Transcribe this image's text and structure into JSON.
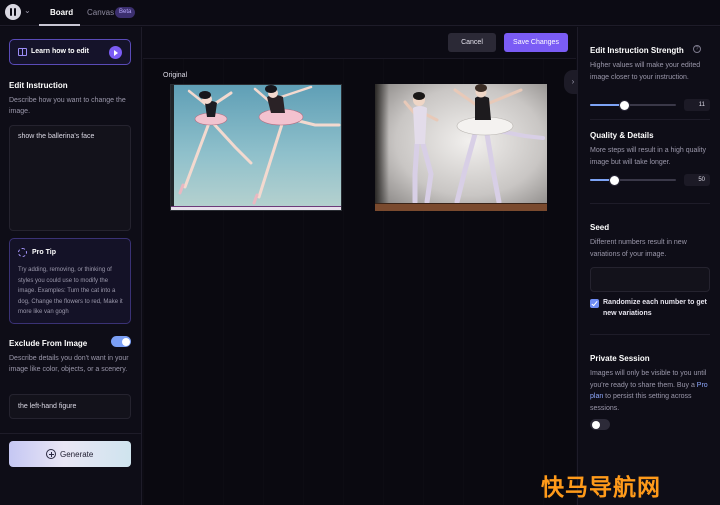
{
  "topbar": {
    "tabs": [
      {
        "label": "Board",
        "active": true
      },
      {
        "label": "Canvas",
        "active": false,
        "badge": "Beta"
      }
    ]
  },
  "left": {
    "learn_button": "Learn how to edit",
    "edit_instruction": {
      "title": "Edit Instruction",
      "description": "Describe how you want to change the image.",
      "value": "show the ballerina's face"
    },
    "pro_tip": {
      "title": "Pro Tip",
      "text": "Try adding, removing, or thinking of styles you could use to modify the image. Examples: Turn the cat into a dog, Change the flowers to red, Make it more like van gogh"
    },
    "exclude": {
      "title": "Exclude From Image",
      "enabled": true,
      "description": "Describe details you don't want in your image like color, objects, or a scenery.",
      "value": "the left-hand figure"
    },
    "generate_button": "Generate"
  },
  "center": {
    "cancel_label": "Cancel",
    "save_label": "Save Changes",
    "original_label": "Original",
    "collapse_icon": "chevron-right-icon"
  },
  "right": {
    "strength": {
      "title": "Edit Instruction Strength",
      "description": "Higher values will make your edited image closer to your instruction.",
      "value": "11",
      "fraction": 0.4
    },
    "quality": {
      "title": "Quality & Details",
      "description": "More steps will result in a high quality image but will take longer.",
      "value": "50",
      "fraction": 0.28
    },
    "seed": {
      "title": "Seed",
      "description": "Different numbers result in new variations of your image.",
      "value": ""
    },
    "randomize": {
      "label": "Randomize each number to get new variations",
      "checked": true
    },
    "private": {
      "title": "Private Session",
      "desc_before": "Images will only be visible to you until you're ready to share them. Buy a ",
      "link": "Pro plan",
      "desc_after": " to persist this setting across sessions.",
      "enabled": false
    }
  },
  "watermark": "快马导航网",
  "colors": {
    "accent": "#7a5cf5",
    "slider": "#7da3f5",
    "background": "#0c0b14"
  }
}
